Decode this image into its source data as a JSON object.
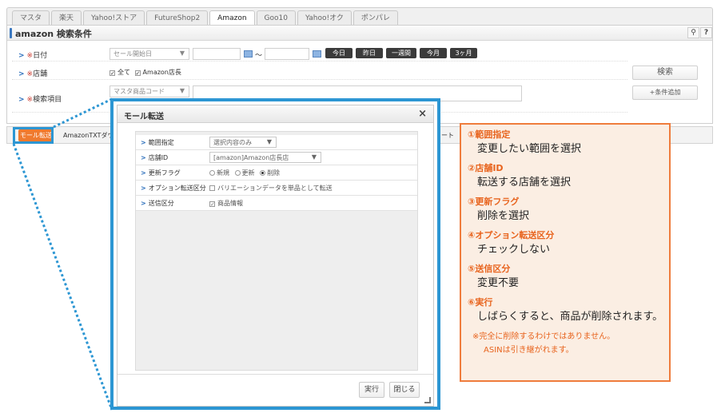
{
  "tabs": [
    "マスタ",
    "楽天",
    "Yahoo!ストア",
    "FutureShop2",
    "Amazon",
    "Goo10",
    "Yahoo!オク",
    "ポンパレ"
  ],
  "active_tab": "Amazon",
  "panel": {
    "title": "amazon 検索条件",
    "search_icon": "search-icon",
    "help_label": "?",
    "date": {
      "label": "日付",
      "req": "※",
      "select_value": "セール開始日",
      "range_sep": "～",
      "buttons": [
        "今日",
        "昨日",
        "一週間",
        "今月",
        "3ヶ月"
      ]
    },
    "store": {
      "label": "店舗",
      "req": "※",
      "all_label": "全て",
      "store_label": "Amazon店長"
    },
    "search_item": {
      "label": "検索項目",
      "req": "※",
      "select_value": "マスタ商品コード"
    },
    "search_button": "検索",
    "add_condition_button": "+条件追加"
  },
  "toolbar": {
    "mall_transfer": "モール転送",
    "amazon_txt": "AmazonTXTダウ",
    "right_fragment": "ート"
  },
  "modal": {
    "title": "モール転送",
    "close": "×",
    "rows": [
      {
        "label": "範囲指定",
        "value": "選択内容のみ"
      },
      {
        "label": "店舗ID",
        "value": "[amazon]Amazon店長店"
      },
      {
        "label": "更新フラグ",
        "options": [
          "新規",
          "更新",
          "削除"
        ],
        "selected": "削除"
      },
      {
        "label": "オプション転送区分",
        "value": "バリエーションデータを単品として転送"
      },
      {
        "label": "送信区分",
        "value": "商品情報"
      }
    ],
    "run_button": "実行",
    "close_button": "閉じる"
  },
  "callout": {
    "items": [
      {
        "head": "①範囲指定",
        "body": "変更したい範囲を選択"
      },
      {
        "head": "②店舗ID",
        "body": "転送する店舗を選択"
      },
      {
        "head": "③更新フラグ",
        "body": "削除を選択"
      },
      {
        "head": "④オプション転送区分",
        "body": "チェックしない"
      },
      {
        "head": "⑤送信区分",
        "body": "変更不要"
      },
      {
        "head": "⑥実行",
        "body": "しばらくすると、商品が削除されます。"
      }
    ],
    "note1": "※完全に削除するわけではありません。",
    "note2": "ASINは引き継がれます。"
  },
  "colors": {
    "accent_blue": "#2c96d3",
    "callout_orange": "#ef7c3c",
    "callout_bg": "#fbeee3",
    "mall_button": "#f07a2e"
  }
}
